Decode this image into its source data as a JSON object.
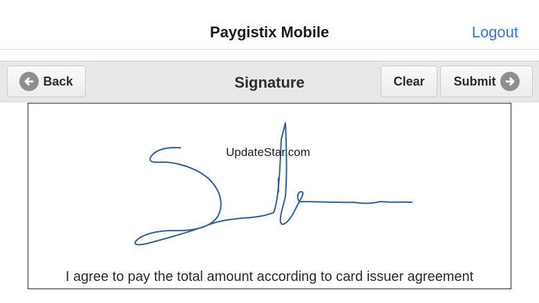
{
  "header": {
    "app_title": "Paygistix Mobile",
    "logout_label": "Logout"
  },
  "toolbar": {
    "back_label": "Back",
    "page_title": "Signature",
    "clear_label": "Clear",
    "submit_label": "Submit"
  },
  "signature": {
    "watermark": "UpdateStar.com",
    "agreement_text": "I agree to pay the total amount according to card issuer agreement",
    "ink_color": "#2f5f9a"
  },
  "colors": {
    "link": "#2a7ae2",
    "toolbar_bg": "#e8e8e8",
    "icon_circle": "#8e8e8e"
  },
  "icons": {
    "back": "arrow-left-circle-icon",
    "submit": "arrow-right-circle-icon"
  }
}
